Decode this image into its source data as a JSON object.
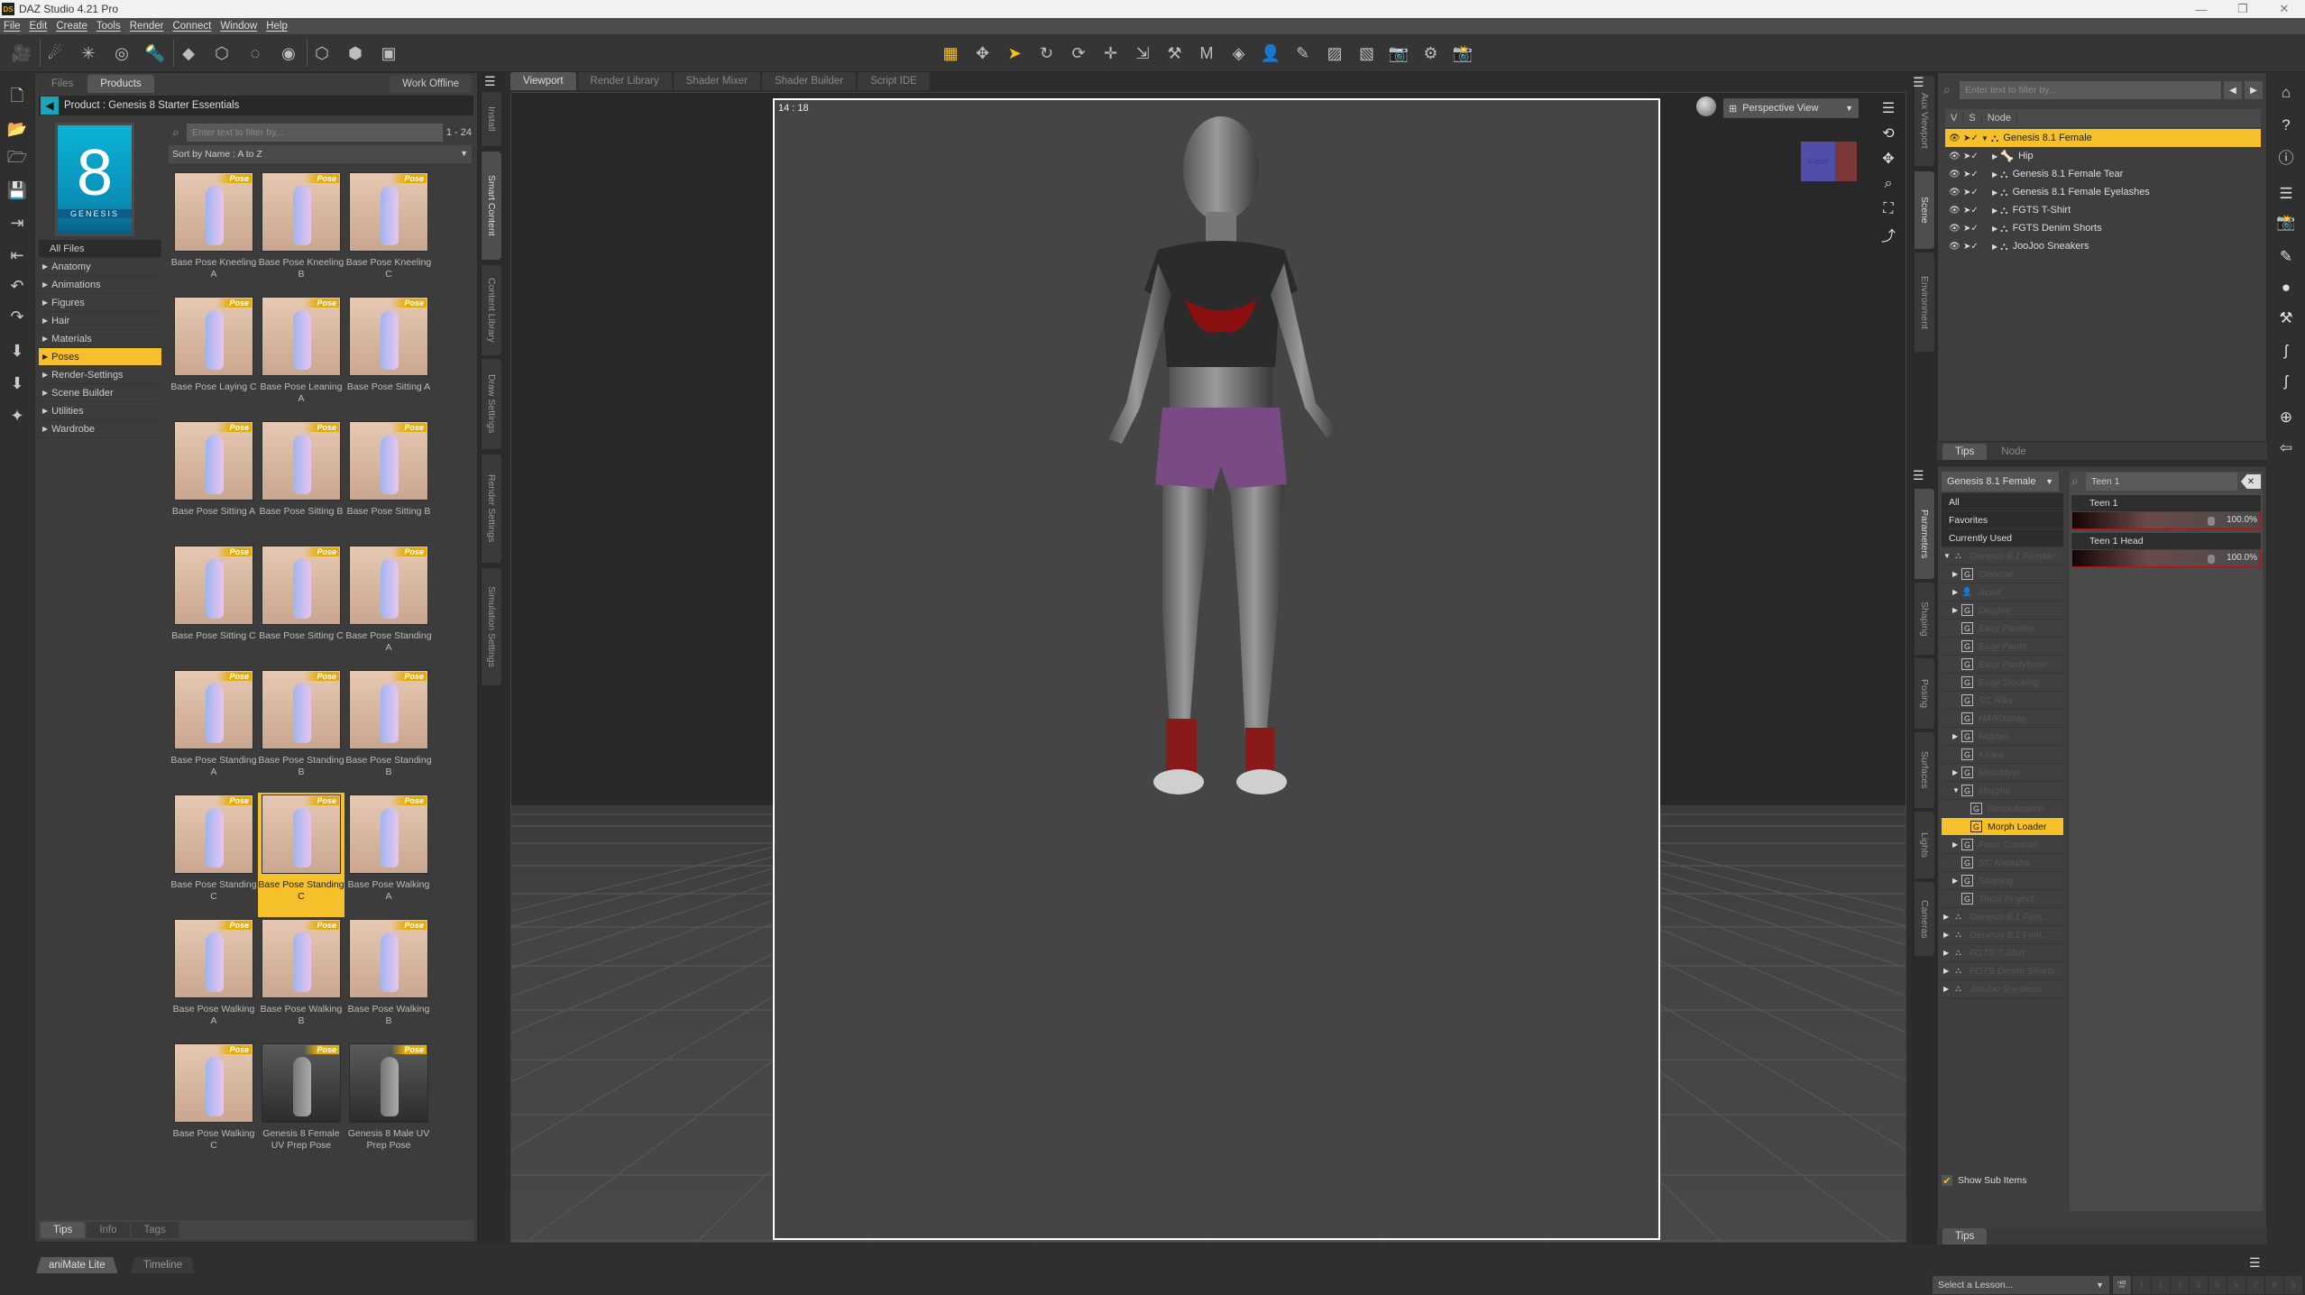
{
  "window": {
    "title": "DAZ Studio 4.21 Pro",
    "logo": "DS",
    "controls": {
      "minimize": "—",
      "restore": "❐",
      "close": "✕"
    }
  },
  "menu": [
    "File",
    "Edit",
    "Create",
    "Tools",
    "Render",
    "Connect",
    "Window",
    "Help"
  ],
  "toolbar": {
    "create_icons": [
      "new-camera-icon",
      "new-distant-light-icon",
      "new-point-light-icon",
      "new-linear-point-light-icon",
      "new-spotlight-icon",
      "new-primitive-icon",
      "new-null-icon",
      "new-group-icon",
      "new-node-instance-icon",
      "new-instance-icon",
      "new-instances-group-icon",
      "new-proxy-icon"
    ],
    "tool_icons": [
      "grid-tool-icon",
      "universal-tool-icon",
      "node-selection-icon",
      "rotate-tool-icon",
      "twist-tool-icon",
      "translate-tool-icon",
      "scale-tool-icon",
      "joint-editor-icon",
      "active-pose-icon",
      "surface-selection-icon",
      "geometry-editor-icon",
      "region-navigator-icon",
      "node-weight-brush-icon",
      "geometry-sculptor-icon",
      "spot-render-icon",
      "render-settings-icon",
      "render-icon"
    ]
  },
  "left_toolbar": [
    "new-scene-icon",
    "open-icon",
    "merge-icon",
    "save-icon",
    "import-icon",
    "export-icon",
    "undo-icon",
    "redo-icon",
    "load-scene-builder-icon",
    "product-library-icon",
    "figure-setup-icon"
  ],
  "content_panel": {
    "tabs": [
      "Files",
      "Products"
    ],
    "active_tab": "Products",
    "work_offline": "Work Offline",
    "product_label": "Product :",
    "product_name": "Genesis 8 Starter Essentials",
    "thumb_number": "8",
    "thumb_brand": "GENESIS",
    "all_files": "All Files",
    "categories": [
      "Anatomy",
      "Animations",
      "Figures",
      "Hair",
      "Materials",
      "Poses",
      "Render-Settings",
      "Scene Builder",
      "Utilities",
      "Wardrobe"
    ],
    "selected_category": "Poses",
    "filter_placeholder": "Enter text to filter by...",
    "range": "1 - 24",
    "sort": "Sort by Name : A to Z",
    "badge": "Pose",
    "items": [
      {
        "label": "Base Pose Kneeling A"
      },
      {
        "label": "Base Pose Kneeling B"
      },
      {
        "label": "Base Pose Kneeling C"
      },
      {
        "label": "Base Pose Laying C"
      },
      {
        "label": "Base Pose Leaning A"
      },
      {
        "label": "Base Pose Sitting A"
      },
      {
        "label": "Base Pose Sitting A"
      },
      {
        "label": "Base Pose Sitting B"
      },
      {
        "label": "Base Pose Sitting B"
      },
      {
        "label": "Base Pose Sitting C"
      },
      {
        "label": "Base Pose Sitting C"
      },
      {
        "label": "Base Pose Standing A"
      },
      {
        "label": "Base Pose Standing A"
      },
      {
        "label": "Base Pose Standing B"
      },
      {
        "label": "Base Pose Standing B"
      },
      {
        "label": "Base Pose Standing C"
      },
      {
        "label": "Base Pose Standing C",
        "selected": true
      },
      {
        "label": "Base Pose Walking A"
      },
      {
        "label": "Base Pose Walking A"
      },
      {
        "label": "Base Pose Walking B"
      },
      {
        "label": "Base Pose Walking B"
      },
      {
        "label": "Base Pose Walking C"
      },
      {
        "label": "Genesis 8 Female UV Prep Pose",
        "dark": true
      },
      {
        "label": "Genesis 8 Male UV Prep Pose",
        "dark": true
      }
    ],
    "bottom_tabs": [
      "Tips",
      "Info",
      "Tags"
    ]
  },
  "left_side_tabs": [
    "Install",
    "Smart Content",
    "Content Library",
    "Draw Settings",
    "Render Settings",
    "Simulation Settings"
  ],
  "left_side_active": "Smart Content",
  "viewport": {
    "tabs": [
      "Viewport",
      "Render Library",
      "Shader Mixer",
      "Shader Builder",
      "Script IDE"
    ],
    "active_tab": "Viewport",
    "aspect": "14 : 18",
    "view_select": "Perspective View",
    "cube_face": "Front",
    "nav_icons": [
      "orbit-icon",
      "pan-icon",
      "zoom-icon",
      "frame-icon",
      "reset-view-icon"
    ]
  },
  "right_side_tabs_top": [
    "Aux Viewport",
    "Scene",
    "Environment"
  ],
  "right_side_tabs_top_active": "Scene",
  "right_side_tabs_bottom": [
    "Parameters",
    "Shaping",
    "Posing",
    "Surfaces",
    "Lights",
    "Cameras"
  ],
  "right_side_tabs_bottom_active": "Parameters",
  "scene": {
    "filter_placeholder": "Enter text to filter by...",
    "columns": [
      "V",
      "S",
      "Node"
    ],
    "nodes": [
      {
        "name": "Genesis 8.1 Female",
        "selected": true,
        "expanded": true,
        "indent": 0,
        "icon": "figure-icon"
      },
      {
        "name": "Hip",
        "indent": 1,
        "icon": "bone-icon"
      },
      {
        "name": "Genesis 8.1 Female Tear",
        "indent": 1,
        "icon": "figure-icon"
      },
      {
        "name": "Genesis 8.1 Female Eyelashes",
        "indent": 1,
        "icon": "figure-icon"
      },
      {
        "name": "FGTS T-Shirt",
        "indent": 1,
        "icon": "figure-icon"
      },
      {
        "name": "FGTS Denim Shorts",
        "indent": 1,
        "icon": "figure-icon"
      },
      {
        "name": "JooJoo Sneakers",
        "indent": 1,
        "icon": "figure-icon"
      }
    ],
    "bottom_tabs": [
      "Tips",
      "Node"
    ]
  },
  "parameters": {
    "figure_select": "Genesis 8.1 Female",
    "top_items": [
      "All",
      "Favorites",
      "Currently Used"
    ],
    "tree": [
      {
        "name": "Genesis 8.1 Female",
        "level": 0,
        "arrow": "▼",
        "icon": "figure"
      },
      {
        "name": "General",
        "level": 1,
        "arrow": "▶"
      },
      {
        "name": "Actor",
        "level": 1,
        "arrow": "▶",
        "icon": "actor"
      },
      {
        "name": "Display",
        "level": 1,
        "arrow": "▶"
      },
      {
        "name": "Easy Panties",
        "level": 1
      },
      {
        "name": "Easy Pants",
        "level": 1
      },
      {
        "name": "Easy Pantyhose",
        "level": 1
      },
      {
        "name": "Easy Stocking",
        "level": 1
      },
      {
        "name": "SC Riks",
        "level": 1
      },
      {
        "name": "HARDstrap",
        "level": 1
      },
      {
        "name": "Hidden",
        "level": 1,
        "arrow": "▶"
      },
      {
        "name": "Kirara",
        "level": 1
      },
      {
        "name": "MetaMyer",
        "level": 1,
        "arrow": "▶"
      },
      {
        "name": "Morphs",
        "level": 1,
        "arrow": "▼"
      },
      {
        "name": "Bimbofication",
        "level": 2
      },
      {
        "name": "Morph Loader",
        "level": 2,
        "selected": true
      },
      {
        "name": "Pose Controls",
        "level": 1,
        "arrow": "▶"
      },
      {
        "name": "SC Natasha",
        "level": 1
      },
      {
        "name": "Shaping",
        "level": 1,
        "arrow": "▶"
      },
      {
        "name": "Thico Project",
        "level": 1
      },
      {
        "name": "Genesis 8.1 Fem...",
        "level": 0,
        "arrow": "▶",
        "icon": "figure"
      },
      {
        "name": "Genesis 8.1 Fem...",
        "level": 0,
        "arrow": "▶",
        "icon": "figure"
      },
      {
        "name": "FGTS T-Shirt",
        "level": 0,
        "arrow": "▶",
        "icon": "figure"
      },
      {
        "name": "FGTS Denim Shorts",
        "level": 0,
        "arrow": "▶",
        "icon": "figure"
      },
      {
        "name": "JooJoo Sneakers",
        "level": 0,
        "arrow": "▶",
        "icon": "figure"
      }
    ],
    "filter_value": "Teen 1",
    "sliders": [
      {
        "name": "Teen 1",
        "value": "100.0%",
        "fraction": 1.0
      },
      {
        "name": "Teen 1 Head",
        "value": "100.0%",
        "fraction": 1.0
      }
    ],
    "show_sub_items": "Show Sub Items",
    "show_sub_checked": true,
    "bottom_tab": "Tips"
  },
  "right_toolbar": [
    "daz-home-icon",
    "whats-this-icon",
    "help-icon",
    "pane-layout-icon",
    "render-icon",
    "pose-tool-icon",
    "node-icon",
    "joint-editor-icon",
    "morph-icon",
    "morph-2-icon",
    "environment-icon",
    "exit-icon"
  ],
  "bottom": {
    "tabs": [
      "aniMate Lite",
      "Timeline"
    ],
    "active_tab": "aniMate Lite",
    "lesson_select": "Select a Lesson...",
    "lesson_steps": [
      "1",
      "2",
      "3",
      "4",
      "5",
      "6",
      "7",
      "8",
      "9"
    ]
  },
  "colors": {
    "accent": "#f5c02a",
    "panel": "#3e3e3e",
    "viewport_bg": "#454545",
    "slider_border": "#a01818"
  }
}
